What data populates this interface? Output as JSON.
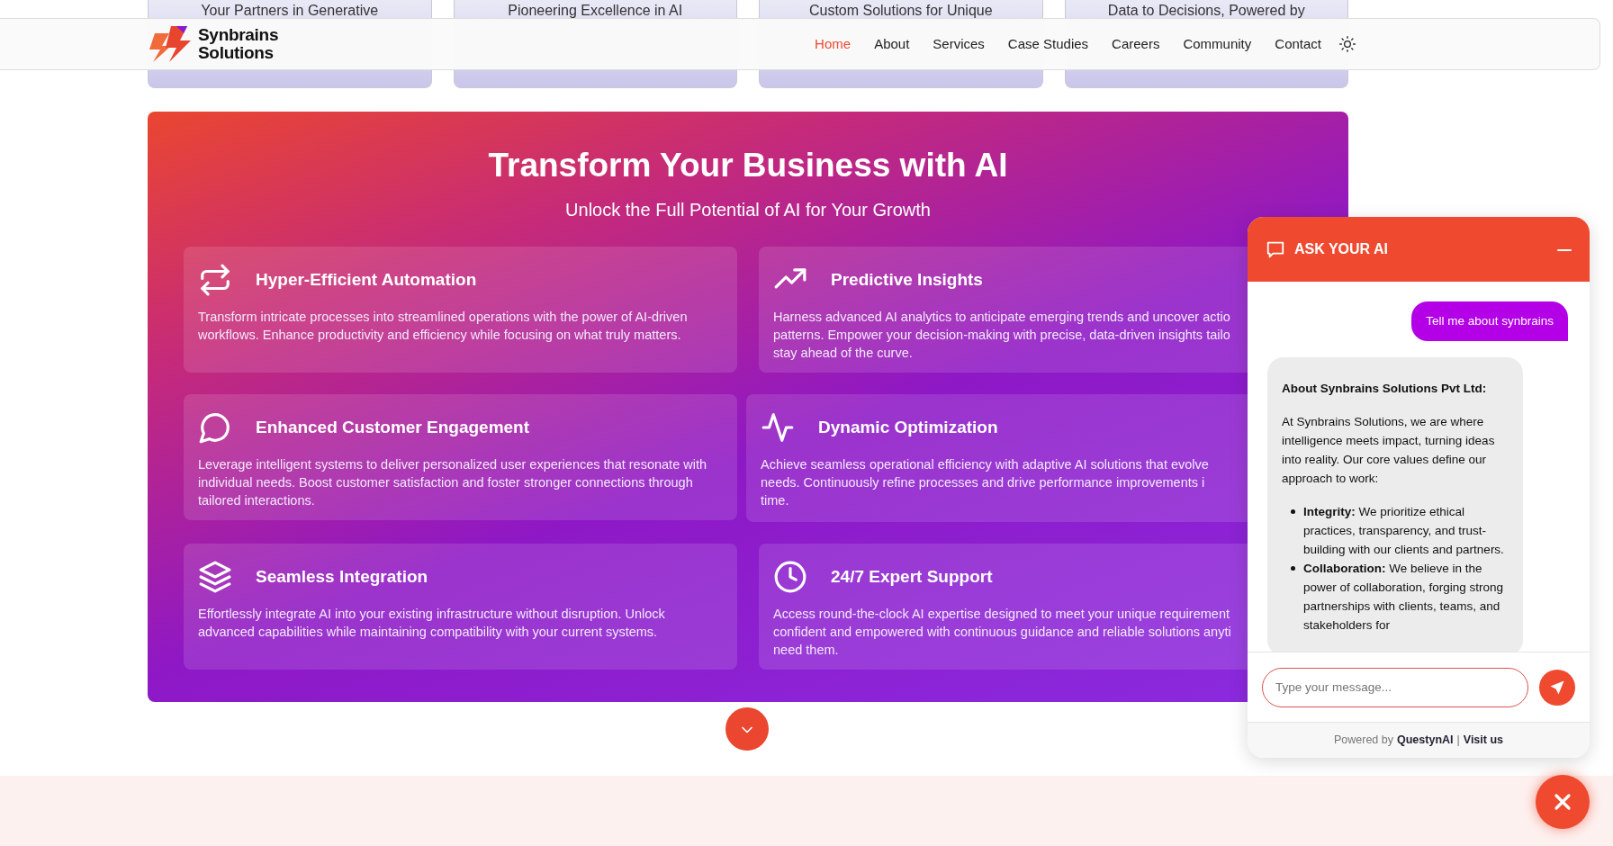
{
  "top_cards": [
    {
      "title": "Your Partners in Generative"
    },
    {
      "title": "Pioneering Excellence in AI"
    },
    {
      "title": "Custom Solutions for Unique"
    },
    {
      "title": "Data to Decisions, Powered by"
    }
  ],
  "navbar": {
    "brand_lines": [
      "Synbrains",
      "Solutions"
    ],
    "links": [
      {
        "label": "Home",
        "selected": true
      },
      {
        "label": "About",
        "selected": false
      },
      {
        "label": "Services",
        "selected": false
      },
      {
        "label": "Case Studies",
        "selected": false
      },
      {
        "label": "Careers",
        "selected": false
      },
      {
        "label": "Community",
        "selected": false
      },
      {
        "label": "Contact",
        "selected": false
      }
    ]
  },
  "hero": {
    "title": "Transform Your Business with AI",
    "subtitle": "Unlock the Full Potential of AI for Your Growth",
    "features": [
      {
        "title": "Hyper-Efficient Automation",
        "lines": [
          "Transform intricate processes into streamlined operations with the power of AI-driven",
          "workflows. Enhance productivity and efficiency while focusing on what truly matters."
        ]
      },
      {
        "title": "Predictive Insights",
        "lines": [
          "Harness advanced AI analytics to anticipate emerging trends and uncover actio",
          "patterns. Empower your decision-making with precise, data-driven insights tailo",
          "stay ahead of the curve."
        ]
      },
      {
        "title": "Enhanced Customer Engagement",
        "lines": [
          "Leverage intelligent systems to deliver personalized user experiences that resonate with",
          "individual needs. Boost customer satisfaction and foster stronger connections through",
          "tailored interactions."
        ]
      },
      {
        "title": "Dynamic Optimization",
        "lines": [
          "Achieve seamless operational efficiency with adaptive AI solutions that evolve",
          "needs. Continuously refine processes and drive performance improvements i",
          "time."
        ]
      },
      {
        "title": "Seamless Integration",
        "lines": [
          "Effortlessly integrate AI into your existing infrastructure without disruption. Unlock",
          "advanced capabilities while maintaining compatibility with your current systems."
        ]
      },
      {
        "title": "24/7 Expert Support",
        "lines": [
          "Access round-the-clock AI expertise designed to meet your unique requirement",
          "confident and empowered with continuous guidance and reliable solutions anyti",
          "need them."
        ]
      }
    ]
  },
  "chat": {
    "title": "ASK YOUR AI",
    "messages": [
      {
        "kind": "user",
        "text": "Tell me about synbrains"
      },
      {
        "kind": "bot",
        "heading": "About Synbrains Solutions Pvt Ltd:",
        "paragraph": "At Synbrains Solutions, we are where intelligence meets impact, turning ideas into reality. Our core values define our approach to work:",
        "items": [
          "**Integrity:** We prioritize ethical practices, transparency, and trust-building with our clients and partners.",
          "**Collaboration:** We believe in the power of collaboration, forging strong partnerships with clients, teams, and stakeholders for"
        ]
      }
    ],
    "input": {
      "placeholder": "Type your message..."
    },
    "footer": {
      "prefix": "Powered by",
      "brand": "QuestynAI",
      "separator": "|",
      "link": "Visit us"
    }
  }
}
